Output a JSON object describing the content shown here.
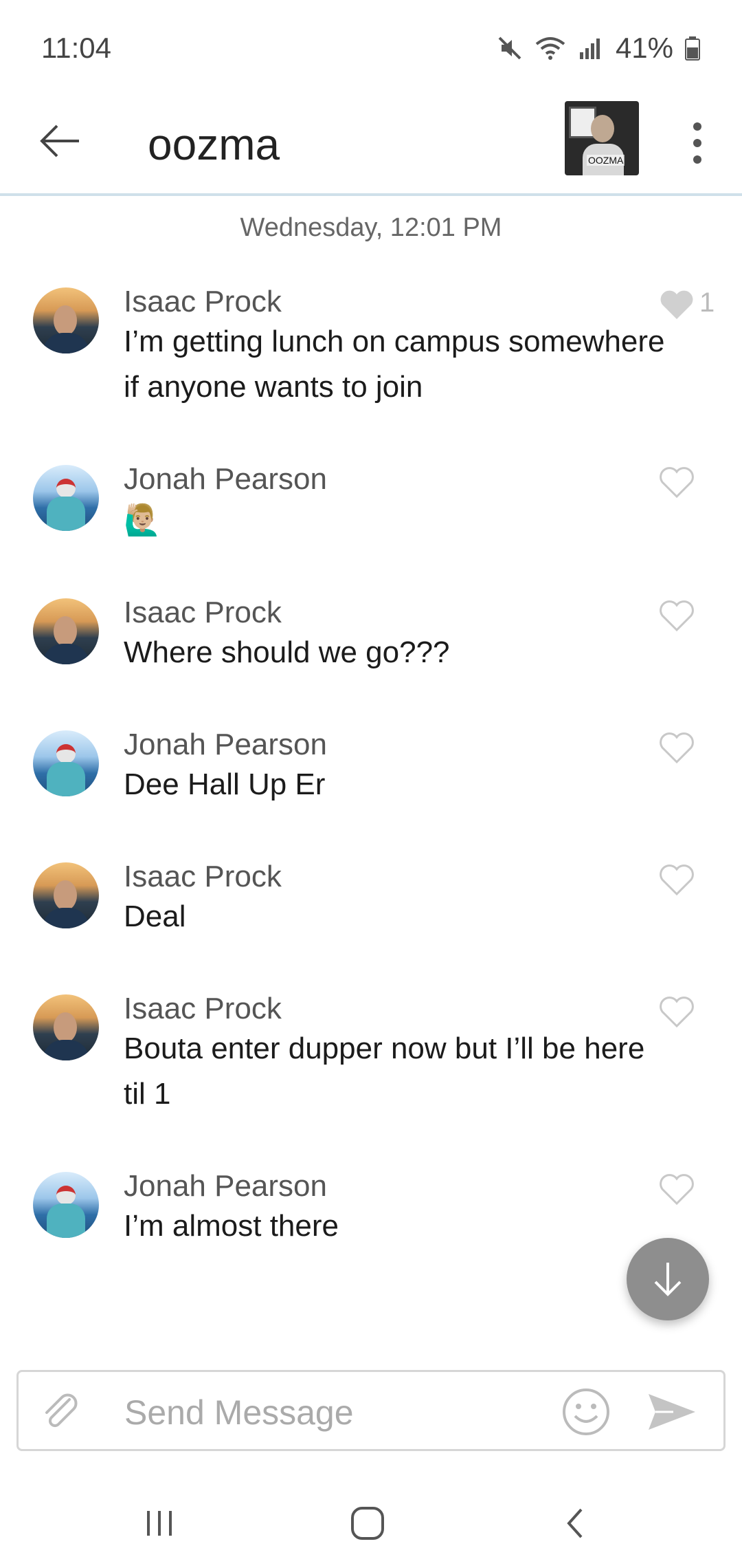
{
  "status_bar": {
    "time": "11:04",
    "battery": "41%"
  },
  "header": {
    "title": "oozma",
    "avatar_label": "OOZMA"
  },
  "timestamp": "Wednesday, 12:01 PM",
  "messages": [
    {
      "author": "Isaac Prock",
      "text": "I’m getting lunch on campus somewhere if anyone wants to join",
      "likes": "1",
      "liked": true
    },
    {
      "author": "Jonah Pearson",
      "text": "🙋🏼‍♂️",
      "likes": "",
      "liked": false
    },
    {
      "author": "Isaac Prock",
      "text": "Where should we go???",
      "likes": "",
      "liked": false
    },
    {
      "author": "Jonah Pearson",
      "text": "Dee Hall Up Er",
      "likes": "",
      "liked": false
    },
    {
      "author": "Isaac Prock",
      "text": "Deal",
      "likes": "",
      "liked": false
    },
    {
      "author": "Isaac Prock",
      "text": "Bouta enter dupper now but I’ll be here til 1",
      "likes": "",
      "liked": false
    },
    {
      "author": "Jonah Pearson",
      "text": "I’m almost there",
      "likes": "",
      "liked": false
    }
  ],
  "composer": {
    "placeholder": "Send Message"
  },
  "icons": {
    "back": "arrow-left-icon",
    "more": "more-vert-icon",
    "heart": "heart-icon",
    "scroll_down": "arrow-down-icon",
    "attach": "paperclip-icon",
    "emoji": "smiley-icon",
    "send": "send-icon"
  },
  "colors": {
    "divider": "#cfe0ea",
    "heart_liked": "#d0d0d0",
    "fab": "#8e8e8e"
  }
}
